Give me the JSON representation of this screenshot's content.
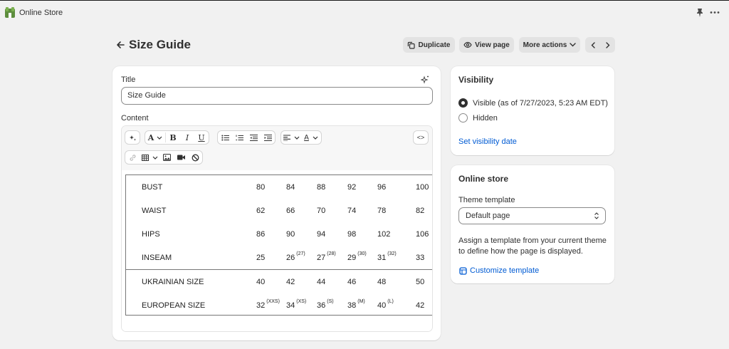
{
  "app": {
    "name": "Online Store"
  },
  "header": {
    "title": "Size Guide",
    "duplicate_label": "Duplicate",
    "view_label": "View page",
    "more_label": "More actions"
  },
  "form": {
    "title_label": "Title",
    "title_value": "Size Guide",
    "content_label": "Content"
  },
  "toolbar": {
    "html_label": "<>"
  },
  "size_table": {
    "rows": [
      {
        "label": "BUST",
        "values": [
          "80",
          "84",
          "88",
          "92",
          "96",
          "100"
        ]
      },
      {
        "label": "WAIST",
        "values": [
          "62",
          "66",
          "70",
          "74",
          "78",
          "82"
        ]
      },
      {
        "label": "HIPS",
        "values": [
          "86",
          "90",
          "94",
          "98",
          "102",
          "106"
        ]
      },
      {
        "label": "INSEAM",
        "values": [
          "25",
          "26",
          "27",
          "29",
          "31",
          "33"
        ],
        "sups": [
          "",
          "(27)",
          "(28)",
          "(30)",
          "(32)",
          ""
        ]
      },
      {
        "label": "UKRAINIAN SIZE",
        "values": [
          "40",
          "42",
          "44",
          "46",
          "48",
          "50"
        ]
      },
      {
        "label": "EUROPEAN SIZE",
        "values": [
          "32",
          "34",
          "36",
          "38",
          "40",
          "42"
        ],
        "sups": [
          "(XXS)",
          "(XS)",
          "(S)",
          "(M)",
          "(L)",
          ""
        ]
      }
    ]
  },
  "visibility": {
    "title": "Visibility",
    "visible_label": "Visible (as of 7/27/2023, 5:23 AM EDT)",
    "hidden_label": "Hidden",
    "set_date_link": "Set visibility date"
  },
  "online_store": {
    "title": "Online store",
    "theme_label": "Theme template",
    "theme_value": "Default page",
    "help_text": "Assign a template from your current theme to define how the page is displayed.",
    "customize_link": "Customize template"
  },
  "colors": {
    "accent": "#005bd3",
    "brand": "#5e8e3e",
    "background": "#f1f1f1"
  }
}
